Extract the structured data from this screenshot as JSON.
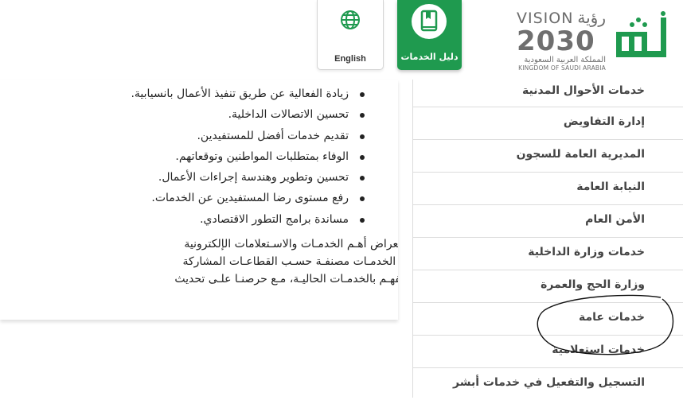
{
  "header": {
    "vision_logo": {
      "word": "VISION",
      "arabic": "رؤية",
      "year": "2030",
      "kingdom_ar": "المملكة العربية السعودية",
      "kingdom_en": "KINGDOM OF SAUDI ARABIA"
    },
    "services_guide_label": "دليل الخدمات",
    "language_label": "English"
  },
  "content": {
    "bullets": [
      "زيادة الفعالية عن طريق تنفيذ الأعمال بانسيابية.",
      "تحسين الاتصالات الداخلية.",
      "تقديم خدمات أفضل للمستفيدين.",
      "الوفاء بمتطلبات المواطنين وتوقعاتهم.",
      "تحسين وتطوير وهندسة إجراءات الأعمال.",
      "رفع مستوى رضا المستفيدين عن الخدمات.",
      "مساندة برامج التطور الاقتصادي."
    ],
    "paragraph_lines": [
      "وفـي هـذا الدليـل تـم اسـتعراض أهـم الخدمـات والاسـتعلامات الإلكترونية",
      "حيـث يعـرض الدليـل هـذه  الخدمـات مصنفـة حسـب القطاعـات المشاركة",
      "مفيـداً للمسـتخدمين لتعريفهـم بالخدمـات الحاليـة، مـع حرصنـا علـى تحديث"
    ]
  },
  "sidebar": {
    "items": [
      "خدمات الأحوال المدنية",
      "إدارة التفاويض",
      "المديرية العامة للسجون",
      "النيابة العامة",
      "الأمن العام",
      "خدمات وزارة الداخلية",
      "وزارة الحج والعمرة",
      "خدمات عامة",
      "خدمات استعلامية",
      "التسجيل والتفعيل في خدمات أبشر"
    ]
  },
  "colors": {
    "brand_green": "#1f9a4f",
    "text": "#222222",
    "border": "#dcdcdc"
  }
}
